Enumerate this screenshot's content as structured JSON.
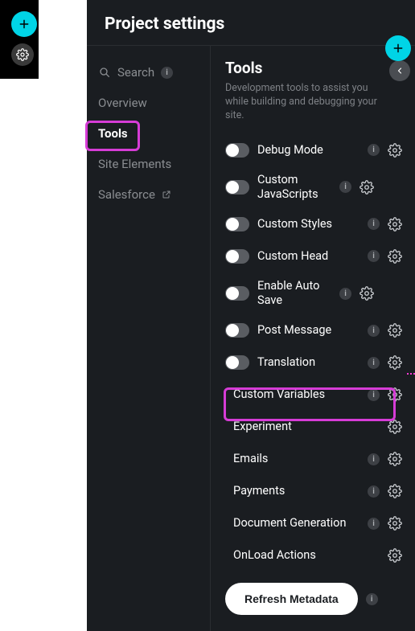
{
  "header": {
    "title": "Project settings"
  },
  "sidebar": {
    "search": "Search",
    "items": [
      {
        "label": "Overview"
      },
      {
        "label": "Tools"
      },
      {
        "label": "Site Elements"
      },
      {
        "label": "Salesforce"
      }
    ]
  },
  "tools": {
    "title": "Tools",
    "description": "Development tools to assist you while building and debugging your site.",
    "items": [
      {
        "label": "Debug Mode",
        "toggle": true,
        "info": true,
        "gear": true
      },
      {
        "label": "Custom JavaScripts",
        "toggle": true,
        "info": true,
        "gear": true,
        "twoline": true
      },
      {
        "label": "Custom Styles",
        "toggle": true,
        "info": true,
        "gear": true
      },
      {
        "label": "Custom Head",
        "toggle": true,
        "info": true,
        "gear": true
      },
      {
        "label": "Enable Auto Save",
        "toggle": true,
        "info": true,
        "gear": true,
        "twoline": true
      },
      {
        "label": "Post Message",
        "toggle": true,
        "info": true,
        "gear": true
      },
      {
        "label": "Translation",
        "toggle": true,
        "info": true,
        "gear": true
      },
      {
        "label": "Custom Variables",
        "toggle": false,
        "info": true,
        "gear": true
      },
      {
        "label": "Experiment",
        "toggle": false,
        "info": false,
        "gear": true
      },
      {
        "label": "Emails",
        "toggle": false,
        "info": true,
        "gear": true
      },
      {
        "label": "Payments",
        "toggle": false,
        "info": true,
        "gear": true
      },
      {
        "label": "Document Generation",
        "toggle": false,
        "info": true,
        "gear": true
      },
      {
        "label": "OnLoad Actions",
        "toggle": false,
        "info": false,
        "gear": true
      }
    ],
    "refresh": "Refresh Metadata"
  },
  "colors": {
    "accent": "#00D4E6",
    "highlight": "#d63cd6",
    "panel": "#1a1d21"
  }
}
